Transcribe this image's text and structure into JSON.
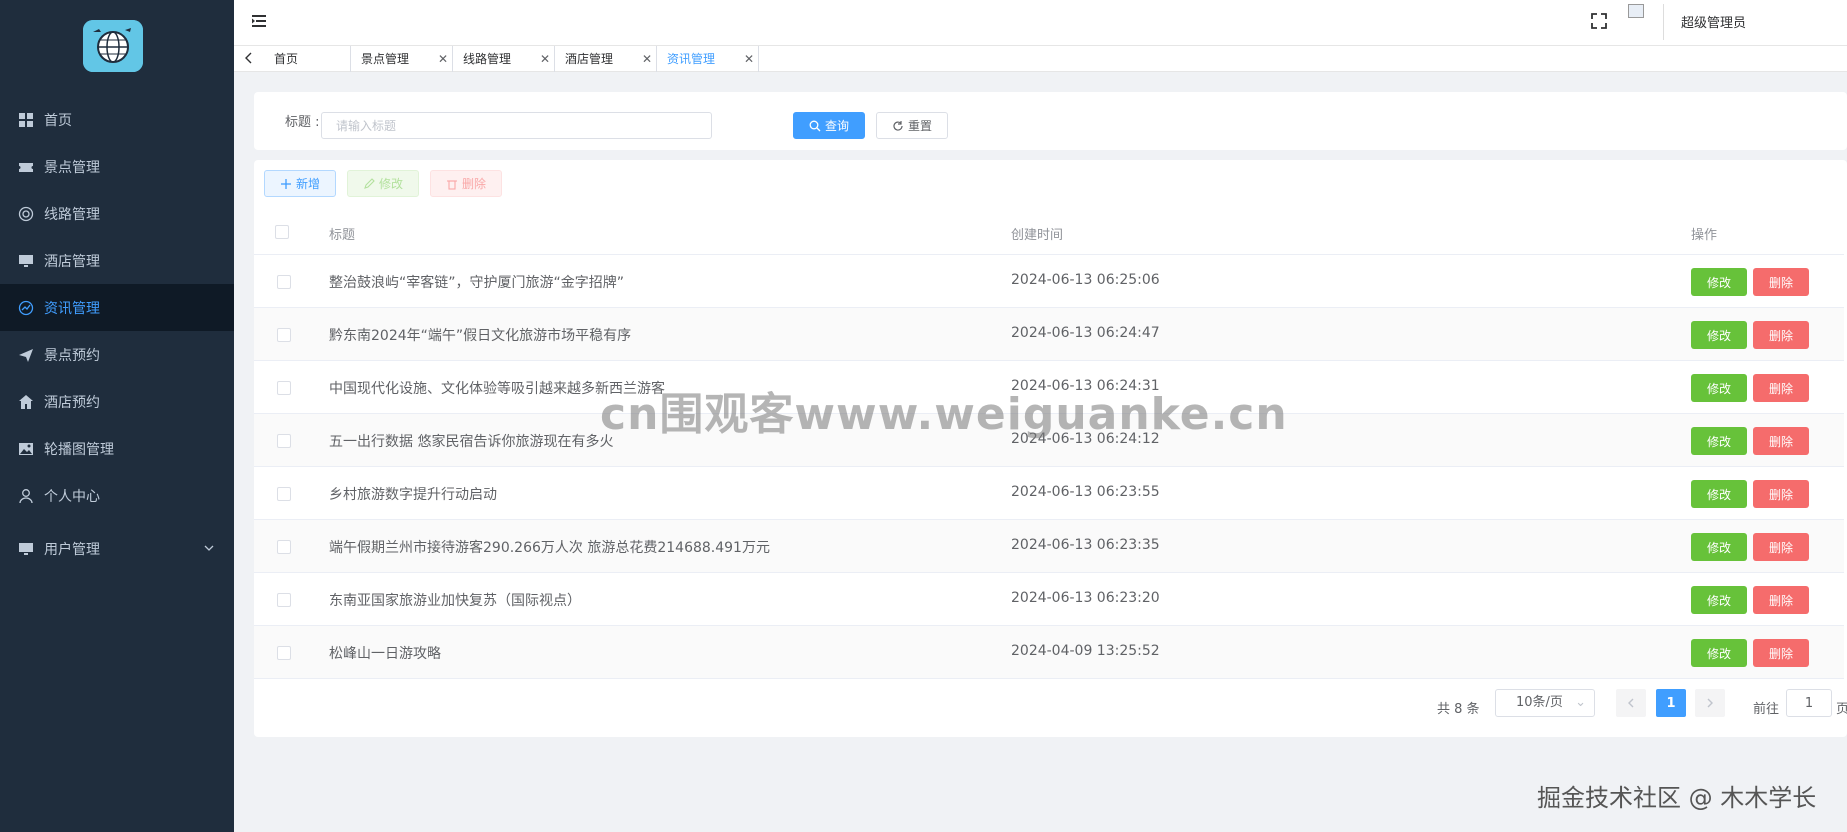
{
  "sidebar": {
    "items": [
      {
        "label": "首页",
        "icon": "dashboard-icon"
      },
      {
        "label": "景点管理",
        "icon": "ticket-icon"
      },
      {
        "label": "线路管理",
        "icon": "globe-icon"
      },
      {
        "label": "酒店管理",
        "icon": "monitor-icon"
      },
      {
        "label": "资讯管理",
        "icon": "chart-icon",
        "active": true
      },
      {
        "label": "景点预约",
        "icon": "send-icon"
      },
      {
        "label": "酒店预约",
        "icon": "home-icon"
      },
      {
        "label": "轮播图管理",
        "icon": "picture-icon"
      },
      {
        "label": "个人中心",
        "icon": "user-icon"
      },
      {
        "label": "用户管理",
        "icon": "monitor-icon",
        "expandable": true
      }
    ]
  },
  "header": {
    "username": "超级管理员"
  },
  "tags": [
    {
      "label": "首页"
    },
    {
      "label": "景点管理",
      "closable": true
    },
    {
      "label": "线路管理",
      "closable": true
    },
    {
      "label": "酒店管理",
      "closable": true
    },
    {
      "label": "资讯管理",
      "closable": true,
      "active": true
    }
  ],
  "search": {
    "label": "标题 :",
    "placeholder": "请输入标题",
    "query_label": "查询",
    "reset_label": "重置"
  },
  "toolbar": {
    "add_label": "新增",
    "edit_label": "修改",
    "delete_label": "删除"
  },
  "table": {
    "columns": [
      "标题",
      "创建时间",
      "操作"
    ],
    "row_edit_label": "修改",
    "row_delete_label": "删除",
    "rows": [
      {
        "title": "整治鼓浪屿“宰客链”，守护厦门旅游“金字招牌”",
        "time": "2024-06-13 06:25:06"
      },
      {
        "title": "黔东南2024年“端午”假日文化旅游市场平稳有序",
        "time": "2024-06-13 06:24:47"
      },
      {
        "title": "中国现代化设施、文化体验等吸引越来越多新西兰游客",
        "time": "2024-06-13 06:24:31"
      },
      {
        "title": "五一出行数据 悠家民宿告诉你旅游现在有多火",
        "time": "2024-06-13 06:24:12"
      },
      {
        "title": "乡村旅游数字提升行动启动",
        "time": "2024-06-13 06:23:55"
      },
      {
        "title": "端午假期兰州市接待游客290.266万人次 旅游总花费214688.491万元",
        "time": "2024-06-13 06:23:35"
      },
      {
        "title": "东南亚国家旅游业加快复苏（国际视点）",
        "time": "2024-06-13 06:23:20"
      },
      {
        "title": "松峰山一日游攻略",
        "time": "2024-04-09 13:25:52"
      }
    ]
  },
  "pagination": {
    "total_text": "共 8 条",
    "page_size": "10条/页",
    "current_page": "1",
    "goto_label": "前往",
    "goto_value": "1",
    "page_suffix": "页"
  },
  "overlay": {
    "watermark": "cn围观客www.weiguanke.cn",
    "footer_mark": "掘金技术社区 @ 木木学长"
  },
  "colors": {
    "sidebar_bg": "#1f2d3d",
    "active_menu_bg": "#0f1a26",
    "primary": "#409eff",
    "success": "#67c23a",
    "danger": "#f56c6c"
  }
}
